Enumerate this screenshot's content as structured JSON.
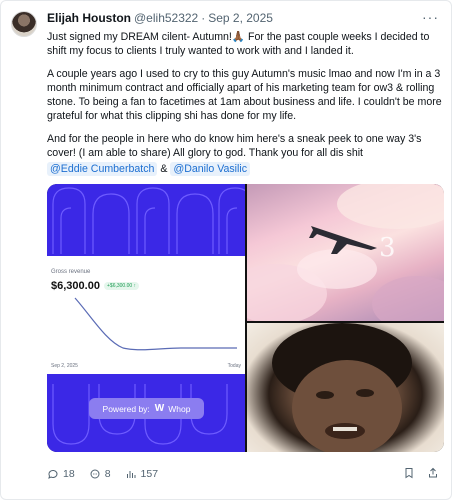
{
  "tweet": {
    "author_name": "Elijah Houston",
    "author_handle": "@elih52322",
    "separator": "·",
    "date": "Sep 2, 2025",
    "more_label": "···",
    "paragraphs": [
      "Just signed my DREAM cilent- Autumn!🙏🏾  For the past couple weeks I decided to shift my focus to clients I truly wanted to work with and I landed it.",
      "A couple years ago I used to cry to this guy Autumn's music lmao and now I'm in a 3 month minimum contract and officially apart of his marketing team for ow3 & rolling stone. To being a fan to facetimes at 1am about business and life. I couldn't be more grateful for what this clipping shi has done for my life.",
      "And for the people in here who do know him here's a sneak peek to one way 3's cover! (I am able to share)  All glory to god. Thank you for all dis shit"
    ],
    "mentions": [
      "@Eddie Cumberbatch",
      "@Danilo Vasilic"
    ],
    "mention_joiner": "&"
  },
  "media": {
    "revenue_card": {
      "label": "Gross revenue",
      "value": "$6,300.00",
      "badge": "+$6,300.00 ↑",
      "start_date": "Sep 2, 2025",
      "end_date": "Today"
    },
    "powered_by": {
      "label": "Powered by:",
      "brand": "Whop"
    }
  },
  "actions": {
    "replies": "18",
    "reposts": "8",
    "views": "157",
    "icons": [
      "reply-icon",
      "repost-icon",
      "views-icon",
      "bookmark-icon",
      "share-icon"
    ]
  },
  "colors": {
    "mention_bg": "#e8f1fb",
    "mention_text": "#1d6fd1",
    "whop_blue": "#3b28e6",
    "muted": "#536471"
  }
}
